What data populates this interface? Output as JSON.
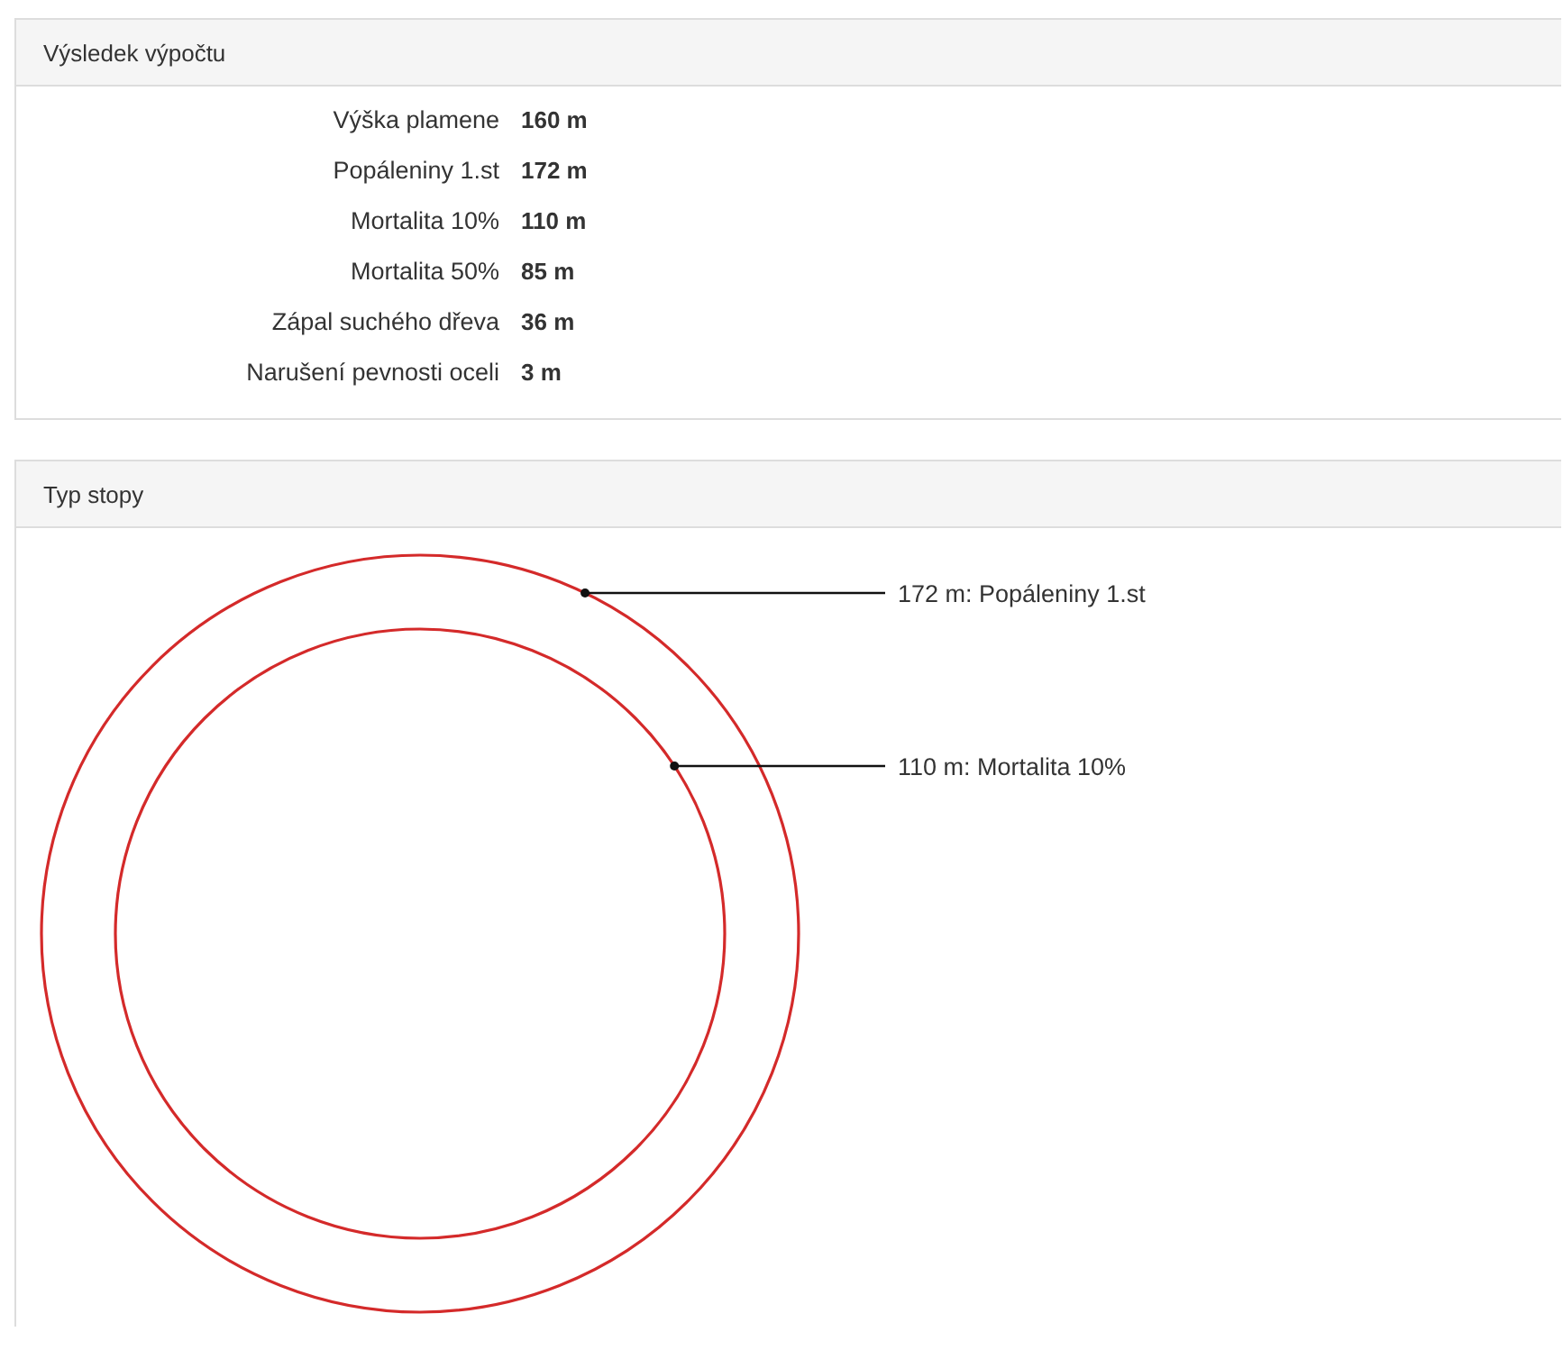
{
  "results": {
    "title": "Výsledek výpočtu",
    "rows": [
      {
        "label": "Výška plamene",
        "value": "160 m"
      },
      {
        "label": "Popáleniny 1.st",
        "value": "172 m"
      },
      {
        "label": "Mortalita 10%",
        "value": "110 m"
      },
      {
        "label": "Mortalita 50%",
        "value": "85 m"
      },
      {
        "label": "Zápal suchého dřeva",
        "value": "36 m"
      },
      {
        "label": "Narušení pevnosti oceli",
        "value": "3 m"
      }
    ]
  },
  "footprint": {
    "title": "Typ stopy",
    "rings": [
      {
        "label": "172 m: Popáleniny 1.st"
      },
      {
        "label": "110 m: Mortalita 10%"
      }
    ]
  }
}
